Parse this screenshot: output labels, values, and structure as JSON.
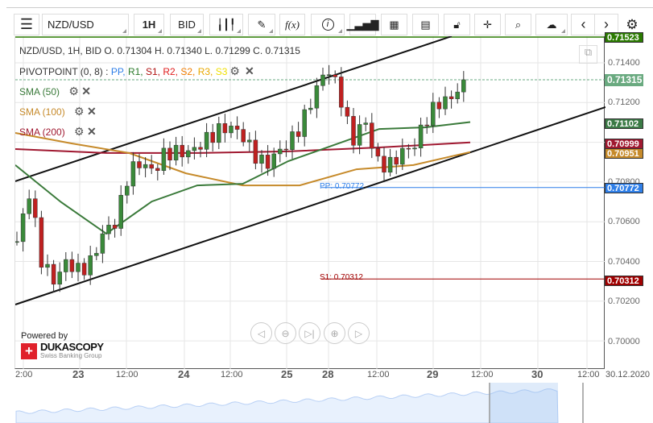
{
  "toolbar": {
    "symbol": "NZD/USD",
    "timeframe": "1H",
    "side": "BID",
    "fx_label": "f(x)"
  },
  "legend": {
    "ohlc": "NZD/USD, 1H, BID   O. 0.71304 H. 0.71340 L. 0.71299 C. 0.71315",
    "pivot_name": "PIVOTPOINT (0, 8)",
    "pivot_sep": " : ",
    "pivot_items": [
      {
        "label": "PP",
        "color": "#2f7fe8"
      },
      {
        "label": "R1",
        "color": "#2a7a2a"
      },
      {
        "label": "S1",
        "color": "#b01010"
      },
      {
        "label": "R2",
        "color": "#e02020"
      },
      {
        "label": "S2",
        "color": "#f07d00"
      },
      {
        "label": "R3",
        "color": "#e8a800"
      },
      {
        "label": "S3",
        "color": "#f0e000"
      }
    ],
    "sma": [
      {
        "label": "SMA (50)",
        "color": "#3a7a3a"
      },
      {
        "label": "SMA (100)",
        "color": "#c68a2a"
      },
      {
        "label": "SMA (200)",
        "color": "#a01830"
      }
    ]
  },
  "price_axis": [
    "0.71400",
    "0.71200",
    "0.70800",
    "0.70600",
    "0.70400",
    "0.70200",
    "0.70000"
  ],
  "price_labels": {
    "top": "0.71523",
    "current": "0.71315",
    "sma50": "0.71102",
    "sma200": "0.70999",
    "sma100": "0.70951",
    "pp": "0.70772",
    "s1": "0.70312"
  },
  "line_labels": {
    "pp": "PP: 0.70772",
    "s1": "S1: 0.70312"
  },
  "time_axis": [
    "2:00",
    "23",
    "12:00",
    "24",
    "12:00",
    "25",
    "28",
    "12:00",
    "29",
    "12:00",
    "30",
    "12:00",
    "30.12.2020"
  ],
  "branding": {
    "powered": "Powered by",
    "name": "DUKASCOPY",
    "sub": "Swiss Banking Group"
  },
  "colors": {
    "up": "#3a8a3a",
    "down": "#c02020",
    "pp": "#2f7fe8",
    "s1": "#a00000",
    "r1": "#2a7a00"
  },
  "chart_data": {
    "type": "candlestick",
    "symbol": "NZD/USD",
    "timeframe": "1H",
    "close_anchors": [
      0.705,
      0.7075,
      0.704,
      0.703,
      0.704,
      0.7035,
      0.704,
      0.7055,
      0.706,
      0.7085,
      0.709,
      0.7085,
      0.7095,
      0.7095,
      0.7095,
      0.71,
      0.7105,
      0.7108,
      0.7105,
      0.7095,
      0.7088,
      0.7095,
      0.71,
      0.711,
      0.7125,
      0.7138,
      0.7125,
      0.71,
      0.7112,
      0.709,
      0.7088,
      0.7095,
      0.7098,
      0.7112,
      0.712,
      0.7122,
      0.71315
    ],
    "sma50": [
      0.70885,
      0.707,
      0.7054,
      0.70702,
      0.70783,
      0.70791,
      0.70905,
      0.70986,
      0.71067,
      0.71075,
      0.71102
    ],
    "sma100": [
      0.71047,
      0.70994,
      0.70946,
      0.70844,
      0.70783,
      0.70783,
      0.70864,
      0.70885,
      0.70951
    ],
    "sma200": [
      0.70966,
      0.70946,
      0.70946,
      0.70954,
      0.70974,
      0.70999
    ],
    "channel_upper": [
      0.70804,
      0.71534
    ],
    "channel_lower": [
      0.70183,
      0.71177
    ],
    "ylim": [
      0.6996,
      0.7153
    ]
  }
}
